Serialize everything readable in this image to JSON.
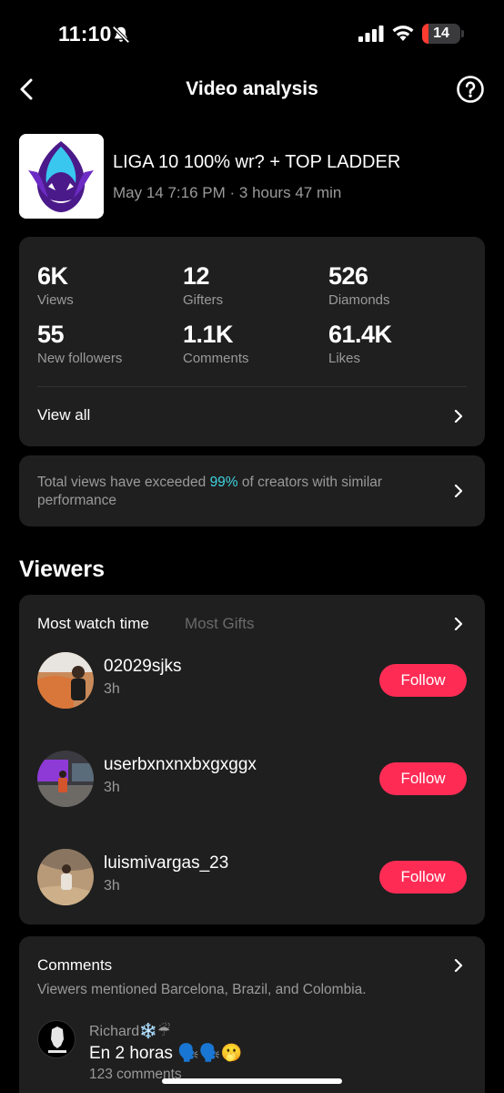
{
  "status_bar": {
    "time": "11:10",
    "battery": "14",
    "icons": [
      "bell-slash-icon",
      "cellular-signal-icon",
      "wifi-icon",
      "battery-icon"
    ]
  },
  "header": {
    "title": "Video analysis",
    "back_icon": "chevron-left-icon",
    "help_icon": "question-circle-icon"
  },
  "video": {
    "title": "LIGA 10 100% wr? + TOP LADDER",
    "meta": "May 14 7:16 PM · 3 hours 47 min"
  },
  "stats": {
    "items": [
      {
        "value": "6K",
        "label": "Views"
      },
      {
        "value": "12",
        "label": "Gifters"
      },
      {
        "value": "526",
        "label": "Diamonds"
      },
      {
        "value": "55",
        "label": "New followers"
      },
      {
        "value": "1.1K",
        "label": "Comments"
      },
      {
        "value": "61.4K",
        "label": "Likes"
      }
    ],
    "view_all": "View all"
  },
  "insight": {
    "prefix": "Total views have exceeded ",
    "highlight": "99%",
    "suffix": " of creators with similar performance",
    "accent_color": "#3fd4e0"
  },
  "viewers": {
    "section_title": "Viewers",
    "tabs": [
      "Most watch time",
      "Most Gifts"
    ],
    "active_tab": "Most watch time",
    "list": [
      {
        "name": "02029sjks",
        "time": "3h",
        "follow": "Follow"
      },
      {
        "name": "userbxnxnxbxgxggx",
        "time": "3h",
        "follow": "Follow"
      },
      {
        "name": "luismivargas_23",
        "time": "3h",
        "follow": "Follow"
      }
    ],
    "follow_color": "#fe2c55"
  },
  "comments": {
    "title": "Comments",
    "summary": "Viewers mentioned Barcelona, Brazil, and Colombia.",
    "top": {
      "author": "Richard❄️☔",
      "text": "En 2 horas 🗣️🗣️🫢",
      "count": "123 comments"
    }
  }
}
